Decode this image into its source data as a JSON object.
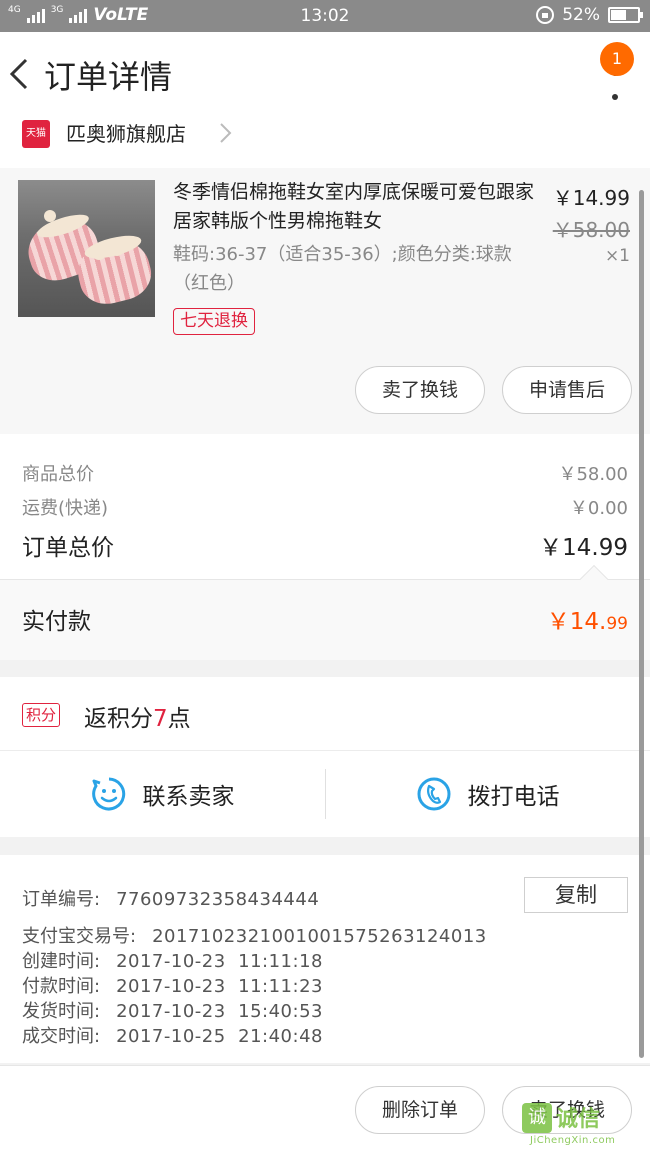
{
  "status_bar": {
    "network": "4G",
    "network2": "3G",
    "carrier": "VoLTE",
    "time": "13:02",
    "battery": "52%",
    "battery_level": 0.52
  },
  "header": {
    "title": "订单详情",
    "badge_count": "1"
  },
  "shop": {
    "tag": "天猫",
    "name": "匹奥狮旗舰店"
  },
  "item": {
    "title": "冬季情侣棉拖鞋女室内厚底保暖可爱包跟家居家韩版个性男棉拖鞋女",
    "spec": "鞋码:36-37（适合35-36）;颜色分类:球款（红色）",
    "return_tag": "七天退换",
    "price": "￥14.99",
    "original_price": "￥58.00",
    "quantity": "×1",
    "btn_resell": "卖了换钱",
    "btn_aftersale": "申请售后"
  },
  "summary": {
    "goods_label": "商品总价",
    "goods_value": "￥58.00",
    "shipping_label": "运费(快递)",
    "shipping_value": "￥0.00",
    "total_label": "订单总价",
    "total_value": "￥14.99",
    "paid_label": "实付款",
    "paid_value_int": "￥14.",
    "paid_value_dec": "99"
  },
  "points": {
    "tag": "积分",
    "text_prefix": "返积分",
    "value": "7",
    "text_suffix": "点"
  },
  "contact": {
    "seller": "联系卖家",
    "phone": "拨打电话"
  },
  "order_info": {
    "order_no_label": "订单编号:",
    "order_no": "77609732358434444",
    "copy_btn": "复制",
    "alipay_label": "支付宝交易号:",
    "alipay_no": "2017102321001001575263124013",
    "created_label": "创建时间:",
    "created": "2017-10-23  11:11:18",
    "paid_label": "付款时间:",
    "paid": "2017-10-23  11:11:23",
    "shipped_label": "发货时间:",
    "shipped": "2017-10-23  15:40:53",
    "completed_label": "成交时间:",
    "completed": "2017-10-25  21:40:48"
  },
  "bottom_bar": {
    "delete_btn": "删除订单",
    "resell_btn": "卖了换钱"
  },
  "watermark": {
    "cn": "诚信",
    "logo_char": "诚",
    "en": "JiChengXin.com"
  }
}
